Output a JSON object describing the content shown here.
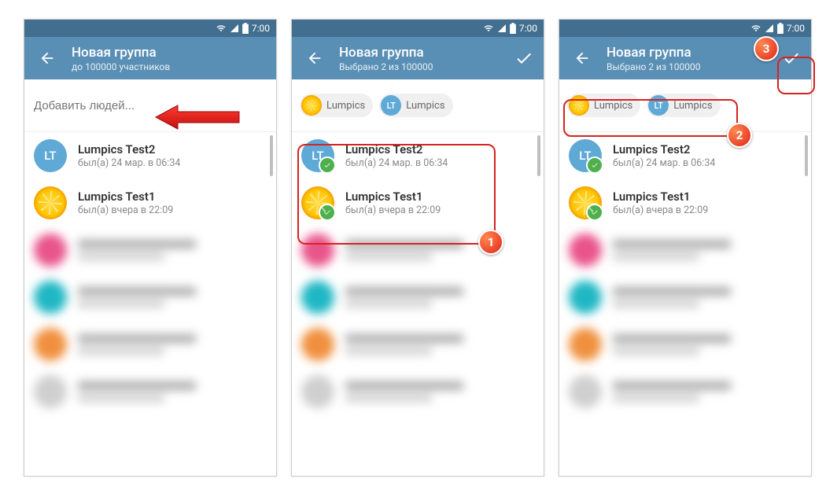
{
  "status": {
    "time": "7:00"
  },
  "screens": [
    {
      "header": {
        "title": "Новая группа",
        "subtitle": "до 100000 участников"
      },
      "search_placeholder": "Добавить людей...",
      "chips": [],
      "contacts": [
        {
          "name": "Lumpics Test2",
          "status": "был(а) 24 мар. в 06:34",
          "avatar_type": "initials",
          "initials": "LT",
          "color": "#5fa9d6",
          "selected": false
        },
        {
          "name": "Lumpics Test1",
          "status": "был(а) вчера в 22:09",
          "avatar_type": "lemon",
          "selected": false
        }
      ]
    },
    {
      "header": {
        "title": "Новая группа",
        "subtitle": "Выбрано 2 из 100000"
      },
      "chips": [
        {
          "label": "Lumpics",
          "avatar_type": "lemon"
        },
        {
          "label": "Lumpics",
          "avatar_type": "initials",
          "initials": "LT",
          "color": "#5fa9d6"
        }
      ],
      "contacts": [
        {
          "name": "Lumpics Test2",
          "status": "был(а) 24 мар. в 06:34",
          "avatar_type": "initials",
          "initials": "LT",
          "color": "#5fa9d6",
          "selected": true
        },
        {
          "name": "Lumpics Test1",
          "status": "был(а) вчера в 22:09",
          "avatar_type": "lemon",
          "selected": true
        }
      ]
    },
    {
      "header": {
        "title": "Новая группа",
        "subtitle": "Выбрано 2 из 100000"
      },
      "chips": [
        {
          "label": "Lumpics",
          "avatar_type": "lemon"
        },
        {
          "label": "Lumpics",
          "avatar_type": "initials",
          "initials": "LT",
          "color": "#5fa9d6"
        }
      ],
      "contacts": [
        {
          "name": "Lumpics Test2",
          "status": "был(а) 24 мар. в 06:34",
          "avatar_type": "initials",
          "initials": "LT",
          "color": "#5fa9d6",
          "selected": true
        },
        {
          "name": "Lumpics Test1",
          "status": "был(а) вчера в 22:09",
          "avatar_type": "lemon",
          "selected": true
        }
      ]
    }
  ],
  "blurred_placeholders": [
    {
      "color": "#e9548a"
    },
    {
      "color": "#1fb7c4"
    },
    {
      "color": "#f0903e"
    },
    {
      "color": "#cfcfcf"
    }
  ],
  "annotations": {
    "step1": "1",
    "step2": "2",
    "step3": "3"
  }
}
